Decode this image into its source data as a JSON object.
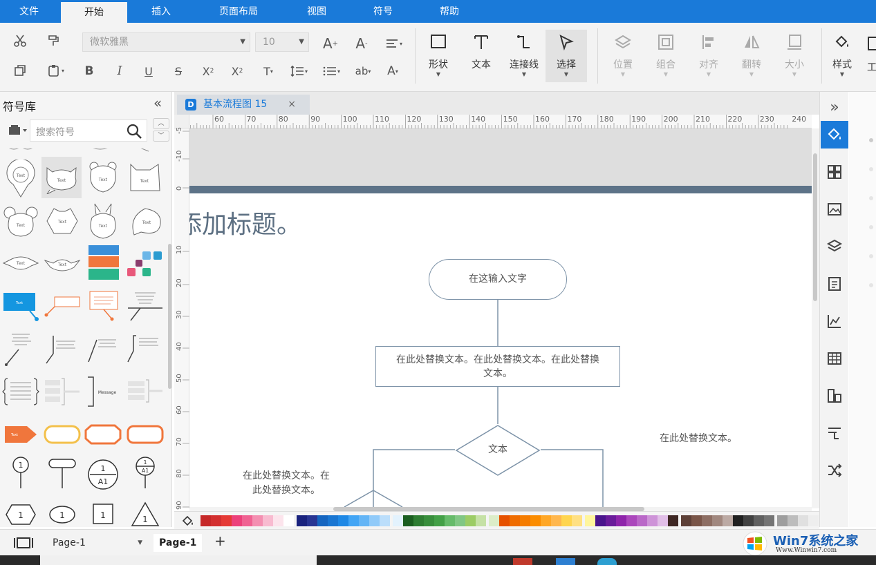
{
  "menu": {
    "tabs": [
      "文件",
      "开始",
      "插入",
      "页面布局",
      "视图",
      "符号",
      "帮助"
    ]
  },
  "ribbon": {
    "font_name": "微软雅黑",
    "font_size": "10",
    "big_buttons": {
      "shape": "形状",
      "text": "文本",
      "connector": "连接线",
      "select": "选择"
    },
    "arrange": {
      "position": "位置",
      "group": "组合",
      "align": "对齐",
      "flip": "翻转",
      "size": "大小"
    },
    "style": "样式",
    "tool_partial": "工",
    "text_tools": {
      "ab": "ab",
      "a_color": "A"
    }
  },
  "sidebar": {
    "title": "符号库",
    "search_placeholder": "搜索符号",
    "collapse": "«",
    "shape_text": "Text",
    "message_label": "Message",
    "numbers": {
      "one": "1",
      "a1": "A1"
    }
  },
  "document": {
    "tab_title": "基本流程图 15",
    "close": "×"
  },
  "rulers": {
    "h": [
      "60",
      "70",
      "80",
      "90",
      "100",
      "110",
      "120",
      "130",
      "140",
      "150",
      "160",
      "170",
      "180",
      "190",
      "200",
      "210",
      "220",
      "230",
      "240"
    ],
    "v": [
      "-5",
      "-10",
      "0",
      "10",
      "20",
      "30",
      "40",
      "50",
      "60",
      "70",
      "80",
      "90"
    ]
  },
  "diagram": {
    "title": "添加标题。",
    "start_node": "在这输入文字",
    "process_node_line1": "在此处替换文本。在此处替换文本。在此处替换",
    "process_node_line2": "文本。",
    "decision_node": "文本",
    "side_text": "在此处替换文本。",
    "left_text_line1": "在此处替换文本。在",
    "left_text_line2": "此处替换文本。"
  },
  "pages": {
    "selector": "Page-1",
    "current": "Page-1",
    "add": "+"
  },
  "watermark": {
    "brand": "Win7系统之家",
    "url": "Www.Winwin7.com"
  },
  "colors": {
    "accent": "#1a7ad9",
    "header_band": "#5d7388",
    "node_stroke": "#7d93a8"
  },
  "palette": [
    "#c62828",
    "#d32f2f",
    "#e53935",
    "#ec407a",
    "#f06292",
    "#f48fb1",
    "#f8bbd0",
    "#fce4ec",
    "#ffffff",
    "#1a237e",
    "#283593",
    "#1565c0",
    "#1976d2",
    "#1e88e5",
    "#42a5f5",
    "#64b5f6",
    "#90caf9",
    "#bbdefb",
    "#e3f2fd",
    "#1b5e20",
    "#2e7d32",
    "#388e3c",
    "#43a047",
    "#66bb6a",
    "#81c784",
    "#9ccc65",
    "#c5e1a5",
    "#dcedc8",
    "#e65100",
    "#ef6c00",
    "#f57c00",
    "#fb8c00",
    "#ffa726",
    "#ffb74d",
    "#ffd54f",
    "#ffe082",
    "#fff59d",
    "#4a148c",
    "#6a1b9a",
    "#8e24aa",
    "#ab47bc",
    "#ba68c8",
    "#ce93d8",
    "#e1bee7",
    "#3e2723",
    "#5d4037",
    "#795548",
    "#8d6e63",
    "#a1887f",
    "#bcaaa4",
    "#212121",
    "#424242",
    "#616161",
    "#757575",
    "#9e9e9e",
    "#bdbdbd",
    "#e0e0e0",
    "#eeeeee"
  ]
}
